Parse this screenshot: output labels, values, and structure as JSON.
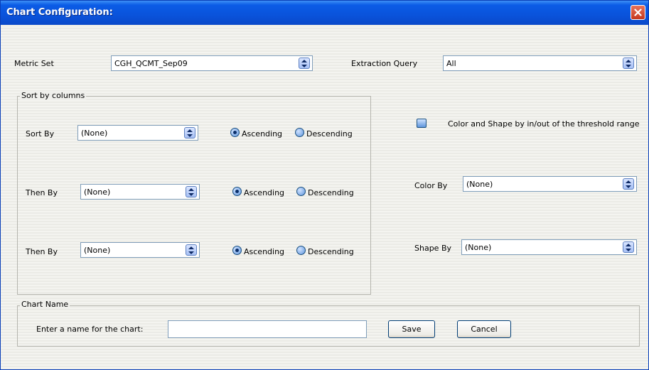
{
  "window": {
    "title": "Chart Configuration:"
  },
  "metric_set": {
    "label": "Metric Set",
    "value": "CGH_QCMT_Sep09"
  },
  "extraction_query": {
    "label": "Extraction Query",
    "value": "All"
  },
  "sort_group": {
    "legend": "Sort by columns",
    "rows": [
      {
        "label": "Sort By",
        "value": "(None)",
        "ascending": "Ascending",
        "descending": "Descending",
        "selected": "Ascending"
      },
      {
        "label": "Then By",
        "value": "(None)",
        "ascending": "Ascending",
        "descending": "Descending",
        "selected": "Ascending"
      },
      {
        "label": "Then By",
        "value": "(None)",
        "ascending": "Ascending",
        "descending": "Descending",
        "selected": "Ascending"
      }
    ]
  },
  "threshold_checkbox": {
    "label": "Color and Shape by in/out of the threshold range",
    "checked": false
  },
  "color_by": {
    "label": "Color By",
    "value": "(None)"
  },
  "shape_by": {
    "label": "Shape By",
    "value": "(None)"
  },
  "chart_name": {
    "legend": "Chart Name",
    "prompt": "Enter a name for the chart:",
    "value": "",
    "save_label": "Save",
    "cancel_label": "Cancel"
  },
  "colors": {
    "title_bar": "#0a53db",
    "close_button": "#c6381d",
    "field_border": "#7f9db9"
  },
  "icons": {
    "close": "close-icon",
    "dropdown": "updown-arrow-icon"
  }
}
